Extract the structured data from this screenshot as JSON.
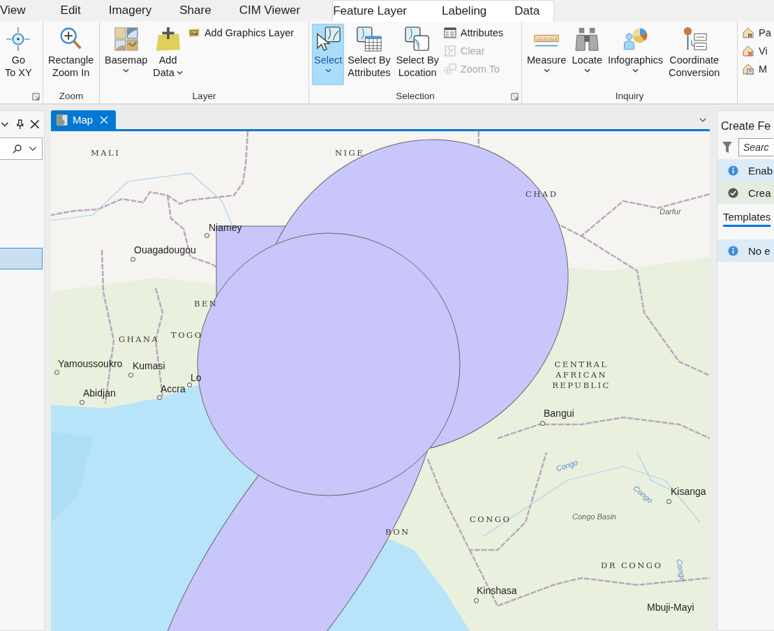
{
  "ribbon_tabs": [
    {
      "label": "View",
      "selected": false
    },
    {
      "label": "Edit",
      "selected": false
    },
    {
      "label": "Imagery",
      "selected": false
    },
    {
      "label": "Share",
      "selected": false
    },
    {
      "label": "CIM Viewer",
      "selected": false
    }
  ],
  "contextual_tabs": [
    {
      "label": "Feature Layer",
      "selected": false
    },
    {
      "label": "Labeling",
      "selected": false
    },
    {
      "label": "Data",
      "selected": false
    }
  ],
  "ribbon_groups": [
    {
      "launcher": true,
      "items": [
        {
          "kind": "large",
          "label": "Go\nTo XY",
          "disabled": false,
          "selected": false
        }
      ]
    },
    {
      "label": "Zoom",
      "items": [
        {
          "kind": "large",
          "label": "Rectangle\nZoom In",
          "disabled": false,
          "selected": false
        }
      ]
    },
    {
      "label": "Layer",
      "items": [
        {
          "kind": "large",
          "label": "Basemap",
          "dropdown": true,
          "disabled": false,
          "selected": false
        },
        {
          "kind": "large",
          "label": "Add\nData",
          "dropdown": true,
          "disabled": false,
          "selected": false
        },
        {
          "kind": "small",
          "label": "Add Graphics Layer",
          "disabled": false,
          "selected": false
        }
      ]
    },
    {
      "label": "Selection",
      "launcher": true,
      "items": [
        {
          "kind": "large",
          "label": "Select",
          "dropdown": true,
          "disabled": false,
          "selected": true
        },
        {
          "kind": "large",
          "label": "Select By\nAttributes",
          "disabled": false,
          "selected": false
        },
        {
          "kind": "large",
          "label": "Select By\nLocation",
          "disabled": false,
          "selected": false
        },
        {
          "kind": "small",
          "label": "Attributes",
          "disabled": false,
          "selected": false
        },
        {
          "kind": "small",
          "label": "Clear",
          "disabled": true,
          "selected": false
        },
        {
          "kind": "small",
          "label": "Zoom To",
          "disabled": true,
          "selected": false
        }
      ]
    },
    {
      "label": "Inquiry",
      "items": [
        {
          "kind": "large",
          "label": "Measure",
          "dropdown": true,
          "disabled": false,
          "selected": false
        },
        {
          "kind": "large",
          "label": "Locate",
          "dropdown": true,
          "disabled": false,
          "selected": false
        },
        {
          "kind": "large",
          "label": "Infographics",
          "dropdown": true,
          "disabled": false,
          "selected": false
        },
        {
          "kind": "large",
          "label": "Coordinate\nConversion",
          "disabled": false,
          "selected": false
        }
      ]
    },
    {
      "items": [
        {
          "kind": "small",
          "label": "Pa",
          "disabled": false,
          "selected": false
        },
        {
          "kind": "small",
          "label": "Vi",
          "disabled": false,
          "selected": false
        },
        {
          "kind": "small",
          "label": "M",
          "disabled": false,
          "selected": false
        }
      ]
    }
  ],
  "left_panel": {
    "list": [
      {
        "selected": true
      }
    ]
  },
  "map_view": {
    "tabs": [
      {
        "label": "Map",
        "selected": true
      }
    ],
    "labels": [
      {
        "text": "MALI",
        "kind": "country"
      },
      {
        "text": "NIGE",
        "kind": "country"
      },
      {
        "text": "CHAD",
        "kind": "country"
      },
      {
        "text": "Darfur",
        "kind": "region"
      },
      {
        "text": "Niamey",
        "kind": "city"
      },
      {
        "text": "Ouagadougou",
        "kind": "city"
      },
      {
        "text": "BEN",
        "kind": "country"
      },
      {
        "text": "GHANA",
        "kind": "country"
      },
      {
        "text": "TOGO",
        "kind": "country"
      },
      {
        "text": "Yamoussoukro",
        "kind": "city"
      },
      {
        "text": "Kumasi",
        "kind": "city"
      },
      {
        "text": "Abidjan",
        "kind": "city"
      },
      {
        "text": "Accra",
        "kind": "city"
      },
      {
        "text": "Lo",
        "kind": "city"
      },
      {
        "text": "CENTRAL AFRICAN REPUBLIC",
        "kind": "country"
      },
      {
        "text": "Bangui",
        "kind": "city"
      },
      {
        "text": "Congo",
        "kind": "river"
      },
      {
        "text": "Congo",
        "kind": "river"
      },
      {
        "text": "Kisanga",
        "kind": "city"
      },
      {
        "text": "Congo Basin",
        "kind": "region"
      },
      {
        "text": "CONGO",
        "kind": "country"
      },
      {
        "text": "BON",
        "kind": "country"
      },
      {
        "text": "DR CONGO",
        "kind": "country"
      },
      {
        "text": "Congo",
        "kind": "river"
      },
      {
        "text": "Kinshasa",
        "kind": "city"
      },
      {
        "text": "Mbuji-Mayi",
        "kind": "city"
      }
    ]
  },
  "right_panel": {
    "title": "Create Fe",
    "search": {
      "placeholder": "Searc"
    },
    "messages": [
      {
        "kind": "info",
        "text": "Enab"
      },
      {
        "kind": "success",
        "text": "Crea"
      }
    ],
    "tabs": [
      {
        "label": "Templates",
        "selected": true
      }
    ],
    "tab_messages": [
      {
        "kind": "info",
        "text": "No e"
      }
    ]
  }
}
